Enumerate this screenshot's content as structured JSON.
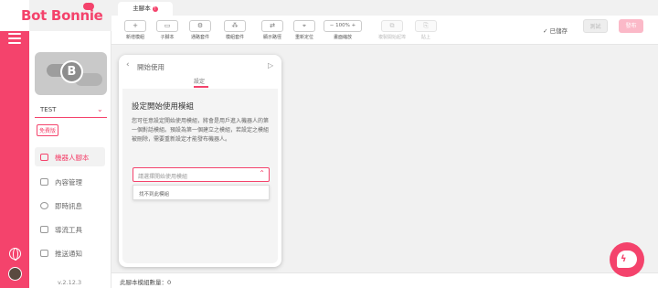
{
  "brand": {
    "logo_text": "Bot Bonnie",
    "accent": "#f4436c"
  },
  "bot": {
    "name": "TEST",
    "avatar_letter": "B",
    "plan_badge": "免費版"
  },
  "nav": [
    {
      "label": "機器人腳本",
      "active": true
    },
    {
      "label": "內容管理",
      "active": false
    },
    {
      "label": "即時訊息",
      "active": false
    },
    {
      "label": "導流工具",
      "active": false
    },
    {
      "label": "推送通知",
      "active": false
    }
  ],
  "version": "v.2.12.3",
  "tabs": [
    {
      "label": "主腳本",
      "badge": "!"
    }
  ],
  "toolbar": {
    "buttons": [
      {
        "label": "新增模組",
        "icon": "plus-icon",
        "glyph": "+",
        "disabled": false
      },
      {
        "label": "子腳本",
        "icon": "folder-icon",
        "glyph": "▭",
        "disabled": false
      },
      {
        "label": "通路套件",
        "icon": "gear-icon",
        "glyph": "⚙",
        "disabled": false
      },
      {
        "label": "模組套件",
        "icon": "nodes-icon",
        "glyph": "⁂",
        "disabled": false
      },
      {
        "label": "顯示路徑",
        "icon": "route-icon",
        "glyph": "⇄",
        "disabled": false
      },
      {
        "label": "重新定位",
        "icon": "target-icon",
        "glyph": "⌖",
        "disabled": false
      }
    ],
    "zoom": {
      "minus": "−",
      "value": "100%",
      "plus": "+",
      "label": "畫面縮放"
    },
    "disabled_buttons": [
      {
        "label": "複製開始起埠",
        "icon": "copy-icon",
        "glyph": "⧉"
      },
      {
        "label": "貼上",
        "icon": "paste-icon",
        "glyph": "⎘"
      }
    ],
    "saved_text": "✓ 已儲存",
    "test_label": "測試",
    "publish_label": "發布"
  },
  "panel": {
    "header_title": "開始使用",
    "tab": "設定",
    "section_title": "設定開始使用模組",
    "description": "您可任意設定開始使用模組，將會是用戶進入機器人的第一個對話模組。預設為第一個建立之模組，若設定之模組被刪除，需要重新設定才能發布機器人。",
    "select_placeholder": "請選擇開始使用模組",
    "dropdown_option": "找不到此模組"
  },
  "status": {
    "text": "此腳本模組數量：0"
  }
}
